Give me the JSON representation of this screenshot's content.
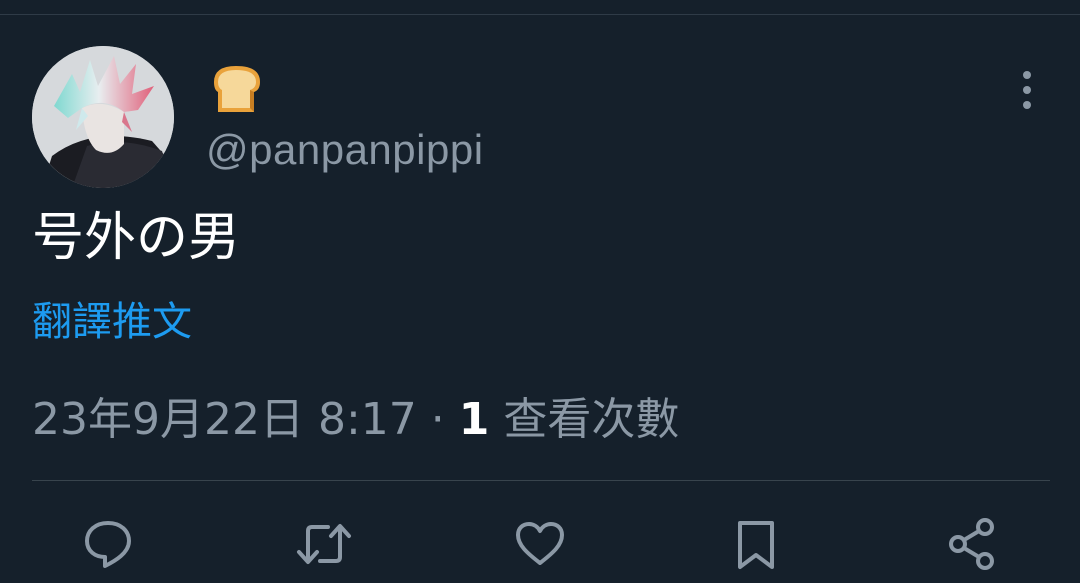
{
  "tweet": {
    "display_name_emoji": "bread-emoji",
    "handle": "@panpanpippi",
    "text": "号外の男",
    "translate_link": "翻譯推文",
    "date": "23年9月22日 8:17",
    "separator": "·",
    "views_count": "1",
    "views_label": "查看次數"
  },
  "actions": [
    {
      "name": "reply",
      "icon": "speech-bubble-icon"
    },
    {
      "name": "retweet",
      "icon": "retweet-arrows-icon"
    },
    {
      "name": "like",
      "icon": "heart-icon"
    },
    {
      "name": "bookmark",
      "icon": "bookmark-icon"
    },
    {
      "name": "share",
      "icon": "share-nodes-icon"
    }
  ],
  "colors": {
    "background": "#15202b",
    "secondary_text": "#8b98a5",
    "link": "#1d9bf0",
    "divider": "#38444d",
    "icon": "#8b98a5"
  }
}
